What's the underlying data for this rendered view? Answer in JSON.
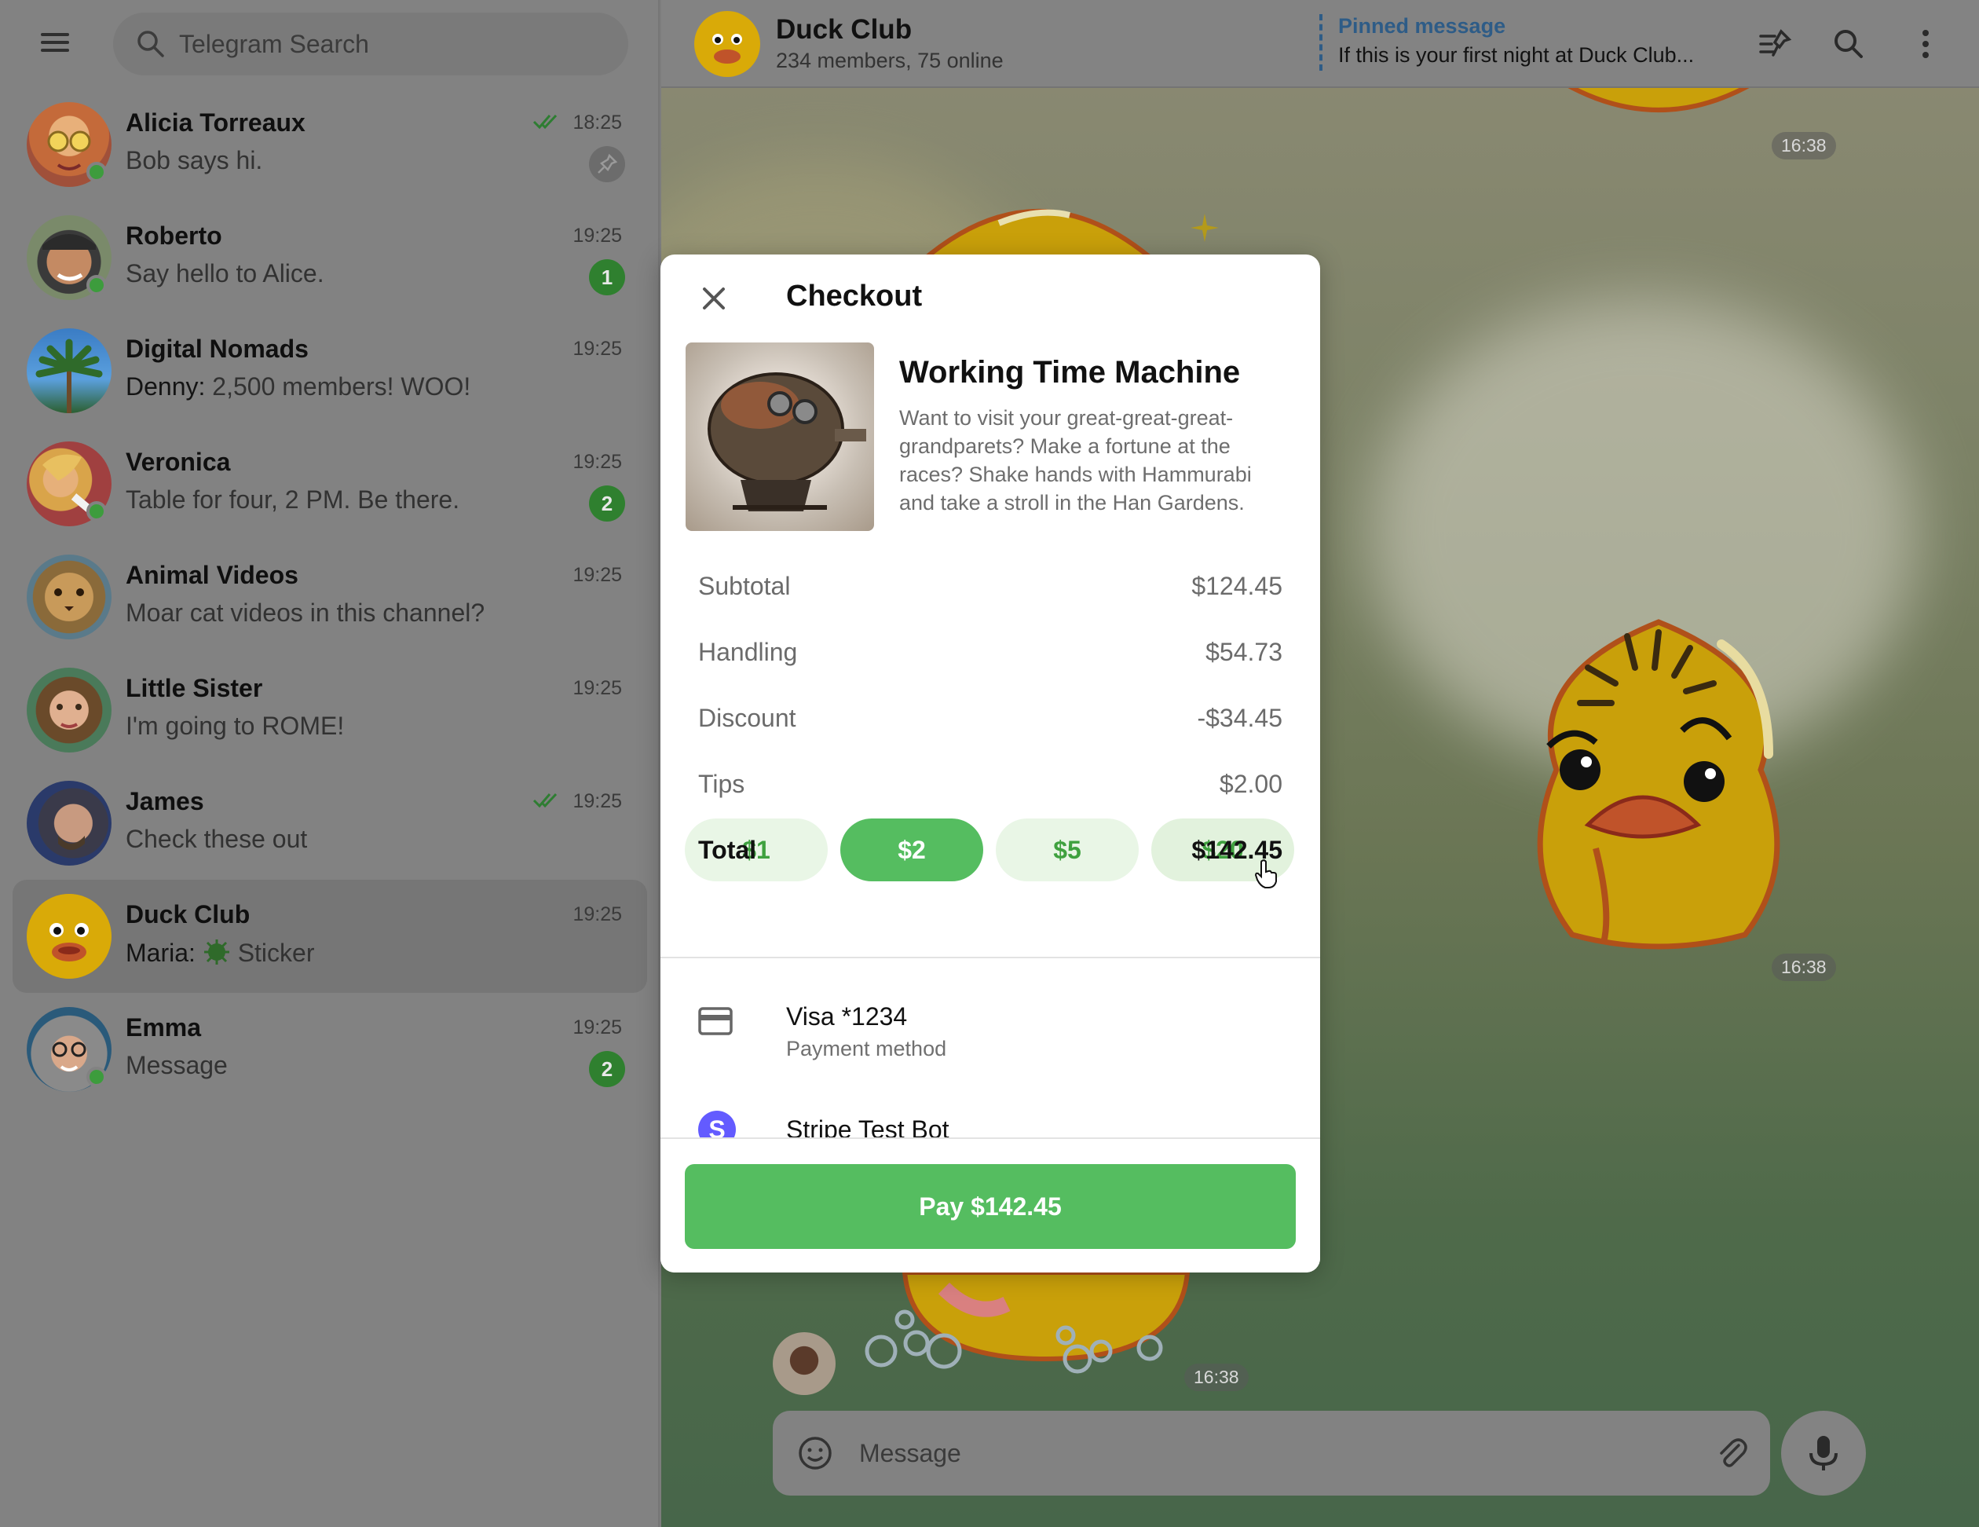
{
  "sidebar": {
    "search_placeholder": "Telegram Search",
    "chats": [
      {
        "name": "Alicia Torreaux",
        "message": "Bob says hi.",
        "time": "18:25",
        "read": true,
        "pinned": true,
        "online": true
      },
      {
        "name": "Roberto",
        "message": "Say hello to Alice.",
        "time": "19:25",
        "badge": "1",
        "online": true
      },
      {
        "name": "Digital Nomads",
        "sender": "Denny:",
        "message": "2,500 members! WOO!",
        "time": "19:25"
      },
      {
        "name": "Veronica",
        "message": "Table for four, 2 PM. Be there.",
        "time": "19:25",
        "badge": "2",
        "online": true
      },
      {
        "name": "Animal Videos",
        "message": "Moar cat videos in this channel?",
        "time": "19:25"
      },
      {
        "name": "Little Sister",
        "message": "I'm going to ROME!",
        "time": "19:25"
      },
      {
        "name": "James",
        "message": "Check these out",
        "time": "19:25",
        "read": true
      },
      {
        "name": "Duck Club",
        "sender": "Maria:",
        "message": "Sticker",
        "time": "19:25",
        "active": true
      },
      {
        "name": "Emma",
        "message": "Message",
        "time": "19:25",
        "badge": "2",
        "online": true
      }
    ]
  },
  "header": {
    "title": "Duck Club",
    "subtitle": "234 members, 75 online",
    "pinned_title": "Pinned message",
    "pinned_text": "If this is your first night at Duck Club..."
  },
  "messages": {
    "times": [
      "16:38",
      "16:38",
      "16:38"
    ]
  },
  "composer": {
    "placeholder": "Message"
  },
  "checkout": {
    "title": "Checkout",
    "product_title": "Working Time Machine",
    "product_description": "Want to visit your great-great-great-grandparets? Make a fortune at the races? Shake hands with Hammurabi and take a stroll in the Han Gardens.",
    "rows": [
      {
        "label": "Subtotal",
        "value": "$124.45"
      },
      {
        "label": "Handling",
        "value": "$54.73"
      },
      {
        "label": "Discount",
        "value": "-$34.45"
      },
      {
        "label": "Tips",
        "value": "$2.00"
      }
    ],
    "tips": [
      "$1",
      "$2",
      "$5",
      "$20"
    ],
    "selected_tip": "$2",
    "total_label": "Total",
    "total_value": "$142.45",
    "payment_method": "Visa *1234",
    "payment_method_label": "Payment method",
    "bot_name": "Stripe Test Bot",
    "bot_initial": "S",
    "pay_label": "Pay $142.45"
  },
  "colors": {
    "accent_green": "#55bd60",
    "link_blue": "#2e5c87"
  }
}
